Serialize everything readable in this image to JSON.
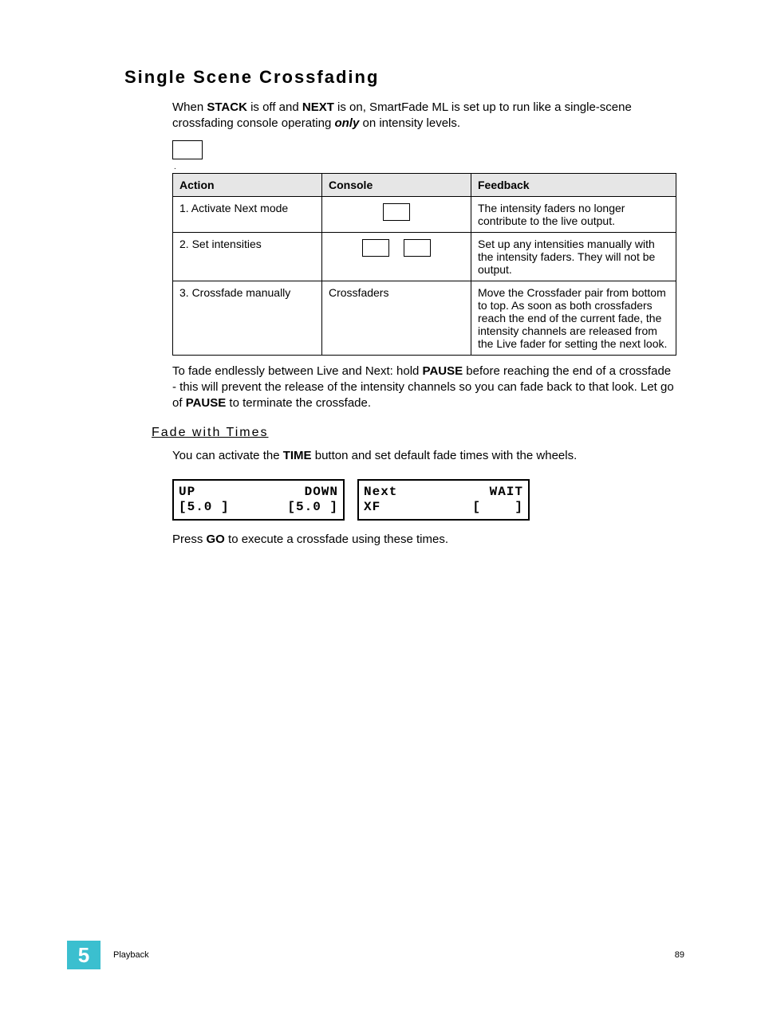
{
  "heading": "Single Scene Crossfading",
  "intro": {
    "pre1": "When ",
    "b1": "STACK",
    "mid1": " is off and ",
    "b2": "NEXT",
    "mid2": " is on, SmartFade ML is set up to run like a single-scene crossfading console operating ",
    "i1": "only",
    "post": " on intensity levels."
  },
  "table": {
    "headers": {
      "action": "Action",
      "console": "Console",
      "feedback": "Feedback"
    },
    "rows": [
      {
        "action": "1. Activate Next mode",
        "console_text": "",
        "box_count": 1,
        "feedback": "The intensity faders no longer contribute to the live output."
      },
      {
        "action": "2. Set intensities",
        "console_text": "",
        "box_count": 2,
        "feedback": "Set up any intensities manually with the intensity faders. They will not be output."
      },
      {
        "action": "3. Crossfade manually",
        "console_text": "Crossfaders",
        "box_count": 0,
        "feedback": "Move the Crossfader pair from bottom to top. As soon as both crossfaders reach the end of the current fade, the intensity channels are released from the Live fader for setting the next look."
      }
    ]
  },
  "after_table": {
    "pre": "To fade endlessly between Live and Next: hold ",
    "b1": "PAUSE",
    "mid": " before reaching the end of a crossfade - this will prevent the release of the intensity channels so you can fade back to that look. Let go of ",
    "b2": "PAUSE",
    "post": " to terminate the crossfade."
  },
  "subheading": "Fade with Times",
  "fade_intro": {
    "pre": "You can activate the ",
    "b1": "TIME",
    "post": " button and set default fade times with the wheels."
  },
  "lcd1": {
    "l1a": "UP",
    "l1b": "DOWN",
    "l2a": "[5.0 ]",
    "l2b": "[5.0 ]"
  },
  "lcd2": {
    "l1a": "Next",
    "l1b": "WAIT",
    "l2a": "XF",
    "l2b": "[    ]"
  },
  "go_line": {
    "pre": "Press ",
    "b1": "GO",
    "post": " to execute a crossfade using these times."
  },
  "footer": {
    "chapter": "5",
    "title": "Playback",
    "page": "89"
  }
}
